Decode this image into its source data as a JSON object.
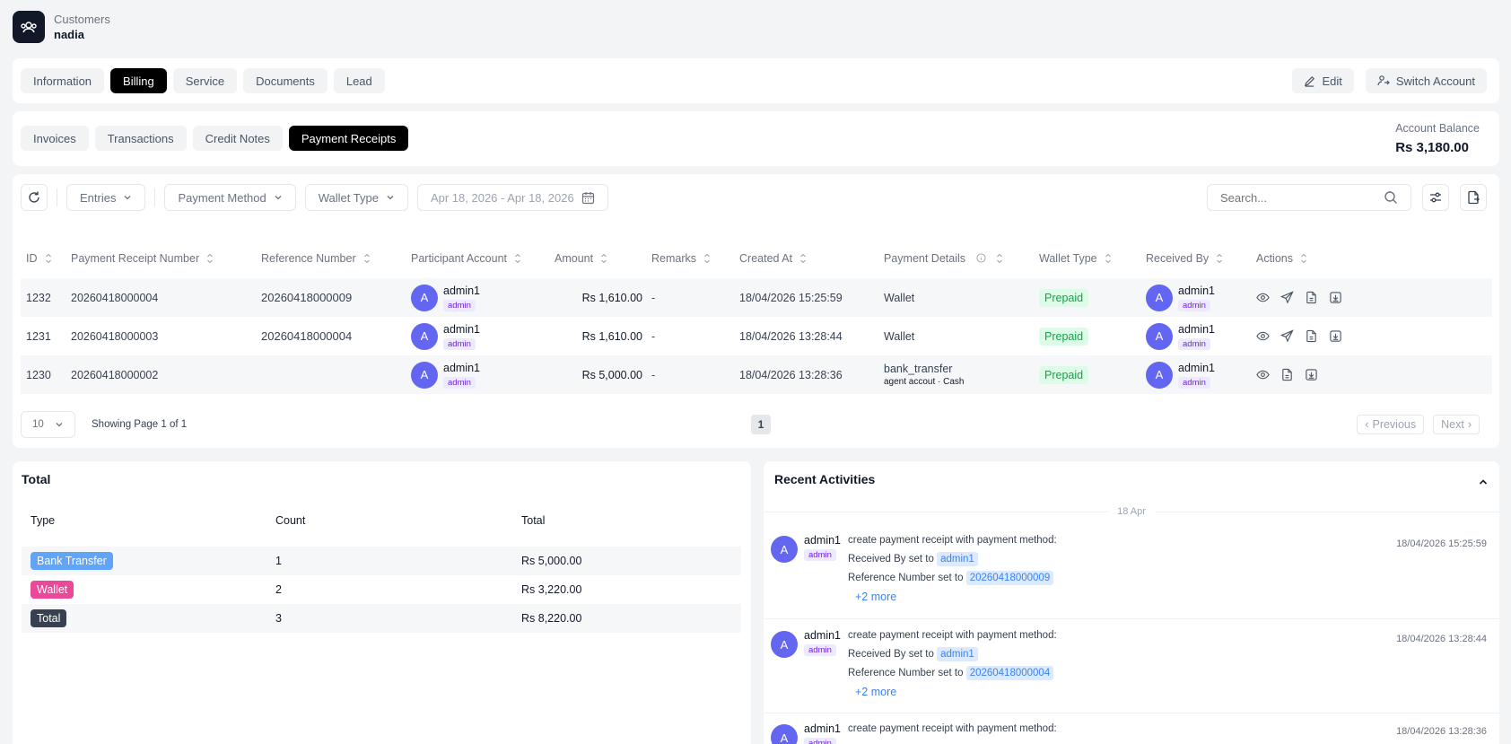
{
  "header": {
    "breadcrumb": "Customers",
    "customer_name": "nadia"
  },
  "main_tabs": [
    "Information",
    "Billing",
    "Service",
    "Documents",
    "Lead"
  ],
  "main_active": "Billing",
  "header_actions": {
    "edit": "Edit",
    "switch_account": "Switch Account"
  },
  "sub_tabs": [
    "Invoices",
    "Transactions",
    "Credit Notes",
    "Payment Receipts"
  ],
  "sub_active": "Payment Receipts",
  "balance": {
    "label": "Account Balance",
    "value": "Rs 3,180.00"
  },
  "filters": {
    "entries": "Entries",
    "payment_method": "Payment Method",
    "wallet_type": "Wallet Type",
    "date_range": "Apr 18, 2026 - Apr 18, 2026",
    "search_placeholder": "Search..."
  },
  "table": {
    "columns": [
      "ID",
      "Payment Receipt Number",
      "Reference Number",
      "Participant Account",
      "Amount",
      "Remarks",
      "Created At",
      "Payment Details",
      "Wallet Type",
      "Received By",
      "Actions"
    ],
    "rows": [
      {
        "id": "1232",
        "receipt": "20260418000004",
        "reference": "20260418000009",
        "participant": "admin1",
        "participant_role": "admin",
        "amount": "Rs 1,610.00",
        "remarks": "-",
        "created": "18/04/2026 15:25:59",
        "details": "Wallet",
        "details_sub": "",
        "wallet": "Prepaid",
        "received_by": "admin1",
        "received_role": "admin"
      },
      {
        "id": "1231",
        "receipt": "20260418000003",
        "reference": "20260418000004",
        "participant": "admin1",
        "participant_role": "admin",
        "amount": "Rs 1,610.00",
        "remarks": "-",
        "created": "18/04/2026 13:28:44",
        "details": "Wallet",
        "details_sub": "",
        "wallet": "Prepaid",
        "received_by": "admin1",
        "received_role": "admin"
      },
      {
        "id": "1230",
        "receipt": "20260418000002",
        "reference": "",
        "participant": "admin1",
        "participant_role": "admin",
        "amount": "Rs 5,000.00",
        "remarks": "-",
        "created": "18/04/2026 13:28:36",
        "details": "bank_transfer",
        "details_sub": "agent accout · Cash",
        "wallet": "Prepaid",
        "received_by": "admin1",
        "received_role": "admin"
      }
    ],
    "avatar_letter": "A"
  },
  "pagination": {
    "page_size": "10",
    "showing": "Showing Page 1 of 1",
    "current_page": "1",
    "previous": "Previous",
    "next": "Next"
  },
  "totals": {
    "title": "Total",
    "headers": [
      "Type",
      "Count",
      "Total"
    ],
    "rows": [
      {
        "type": "Bank Transfer",
        "count": "1",
        "total": "Rs 5,000.00",
        "color": "#60a5fa"
      },
      {
        "type": "Wallet",
        "count": "2",
        "total": "Rs 3,220.00",
        "color": "#ec4899"
      },
      {
        "type": "Total",
        "count": "3",
        "total": "Rs 8,220.00",
        "color": "#374151"
      }
    ]
  },
  "activities": {
    "title": "Recent Activities",
    "date": "18 Apr",
    "items": [
      {
        "user": "admin1",
        "role": "admin",
        "action": "create payment receipt with payment method:",
        "received_label": "Received By set to",
        "received_value": "admin1",
        "ref_label": "Reference Number set to",
        "ref_value": "20260418000009",
        "more": "+2 more",
        "time": "18/04/2026 15:25:59"
      },
      {
        "user": "admin1",
        "role": "admin",
        "action": "create payment receipt with payment method:",
        "received_label": "Received By set to",
        "received_value": "admin1",
        "ref_label": "Reference Number set to",
        "ref_value": "20260418000004",
        "more": "+2 more",
        "time": "18/04/2026 13:28:44"
      },
      {
        "user": "admin1",
        "role": "admin",
        "action": "create payment receipt with payment method:",
        "received_label": "",
        "received_value": "",
        "ref_label": "",
        "ref_value": "",
        "more": "",
        "time": "18/04/2026 13:28:36"
      }
    ]
  }
}
